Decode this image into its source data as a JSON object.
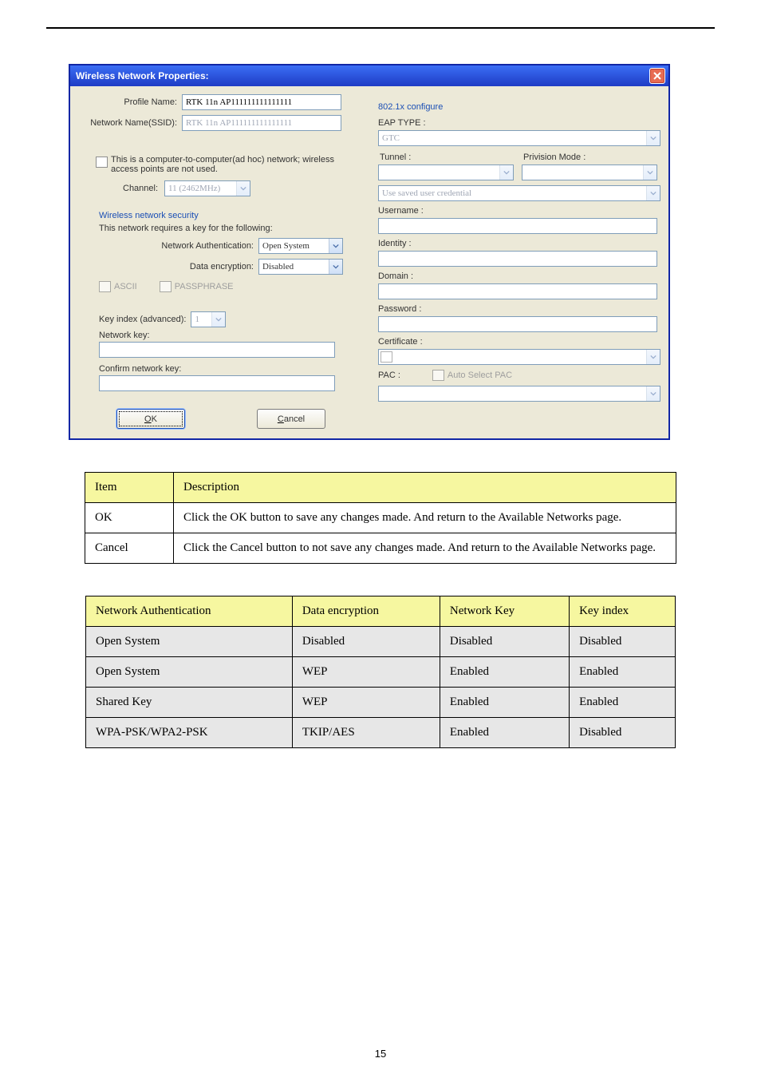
{
  "page": {
    "number": "15"
  },
  "dialog": {
    "title": "Wireless Network Properties:",
    "left": {
      "profile_label": "Profile Name:",
      "profile_value": "RTK 11n AP111111111111111",
      "ssid_label": "Network Name(SSID):",
      "ssid_value": "RTK 11n AP111111111111111",
      "adhoc": "This is a computer-to-computer(ad hoc) network; wireless access points are not used.",
      "channel_label": "Channel:",
      "channel_value": "11 (2462MHz)",
      "sec_group": "Wireless network security",
      "sec_text": "This network requires a key for the following:",
      "auth_label": "Network Authentication:",
      "auth_value": "Open System",
      "enc_label": "Data encryption:",
      "enc_value": "Disabled",
      "ascii": "ASCII",
      "passphrase": "PASSPHRASE",
      "keyidx_label": "Key index (advanced):",
      "keyidx_value": "1",
      "netkey_label": "Network key:",
      "confkey_label": "Confirm network key:",
      "ok": "OK",
      "ok_u": "O",
      "ok_rest": "K",
      "cancel": "Cancel",
      "cancel_u": "C",
      "cancel_rest": "ancel"
    },
    "right": {
      "group": "802.1x configure",
      "eap_label": "EAP TYPE :",
      "eap_value": "GTC",
      "tunnel_label": "Tunnel :",
      "priv_label": "Privision Mode :",
      "saved_cred": "Use saved user credential",
      "username_label": "Username :",
      "identity_label": "Identity :",
      "domain_label": "Domain :",
      "password_label": "Password :",
      "cert_label": "Certificate :",
      "pac_label": "PAC :",
      "pac_auto": "Auto Select PAC"
    }
  },
  "table1": {
    "h1": "Item",
    "h2": "Description",
    "r1a": "OK",
    "r1b": "Click the OK button to save any changes made.  And return to the Available Networks page.",
    "r2a": "Cancel",
    "r2b": "Click the Cancel button to not save any changes made.  And return to the Available Networks page."
  },
  "table2": {
    "h1": "Network Authentication",
    "h2": "Data encryption",
    "h3": "Network Key",
    "h4": "Key index",
    "r1": [
      "Open System",
      "Disabled",
      "Disabled",
      "Disabled"
    ],
    "r2": [
      "Open System",
      "WEP",
      "Enabled",
      "Enabled"
    ],
    "r3": [
      "Shared Key",
      "WEP",
      "Enabled",
      "Enabled"
    ],
    "r4": [
      "WPA-PSK/WPA2-PSK",
      "TKIP/AES",
      "Enabled",
      "Disabled"
    ]
  }
}
